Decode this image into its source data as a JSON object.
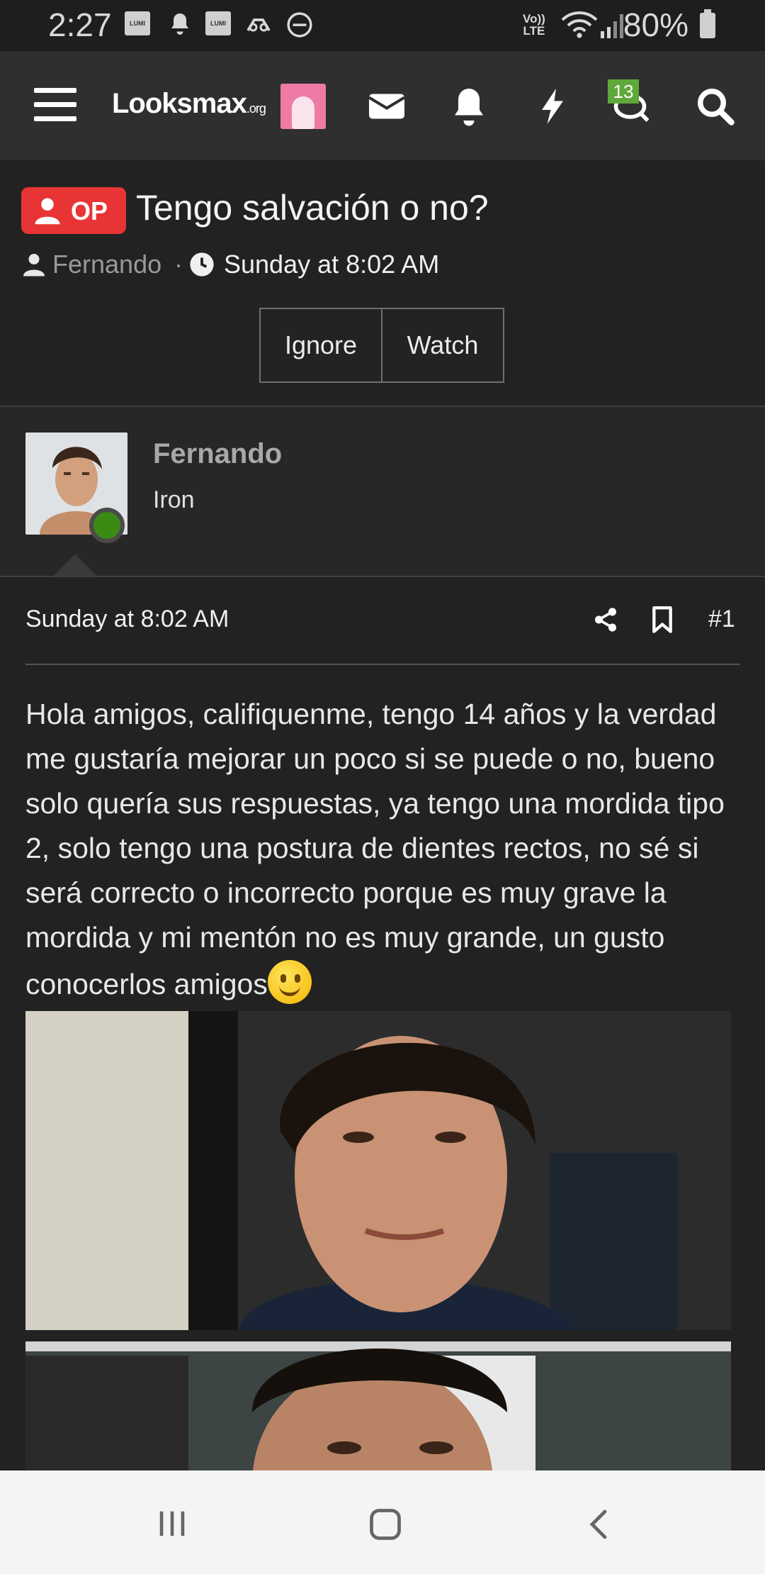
{
  "status_bar": {
    "time": "2:27",
    "lumi_label": "LUMI",
    "volte_line1": "Vo))",
    "volte_line2": "LTE",
    "battery": "80%"
  },
  "header": {
    "logo_main": "Looksmax",
    "logo_suffix": ".org",
    "conversations_badge": "13",
    "icons": [
      "menu-icon",
      "avatar",
      "envelope-icon",
      "bell-icon",
      "bolt-icon",
      "conversations-icon",
      "search-icon"
    ]
  },
  "thread": {
    "op_label": "OP",
    "title": "Tengo salvación o no?",
    "author": "Fernando",
    "separator": "·",
    "date": "Sunday at 8:02 AM",
    "ignore_label": "Ignore",
    "watch_label": "Watch"
  },
  "user": {
    "name": "Fernando",
    "rank": "Iron",
    "online_color": "#3b8a14"
  },
  "post": {
    "date": "Sunday at 8:02 AM",
    "number": "#1",
    "body": "Hola amigos, califiquenme, tengo 14 años y la verdad me gustaría mejorar un poco si se puede o no, bueno solo quería sus respuestas, ya tengo una mordida tipo 2, solo tengo una postura de dientes rectos, no sé si será correcto o incorrecto porque es muy grave la mordida y mi mentón no es muy grande, un gusto conocerlos amigos"
  },
  "colors": {
    "background": "#222222",
    "header": "#2f2f2f",
    "op_badge": "#e83434",
    "badge_green": "#5fa83a"
  }
}
